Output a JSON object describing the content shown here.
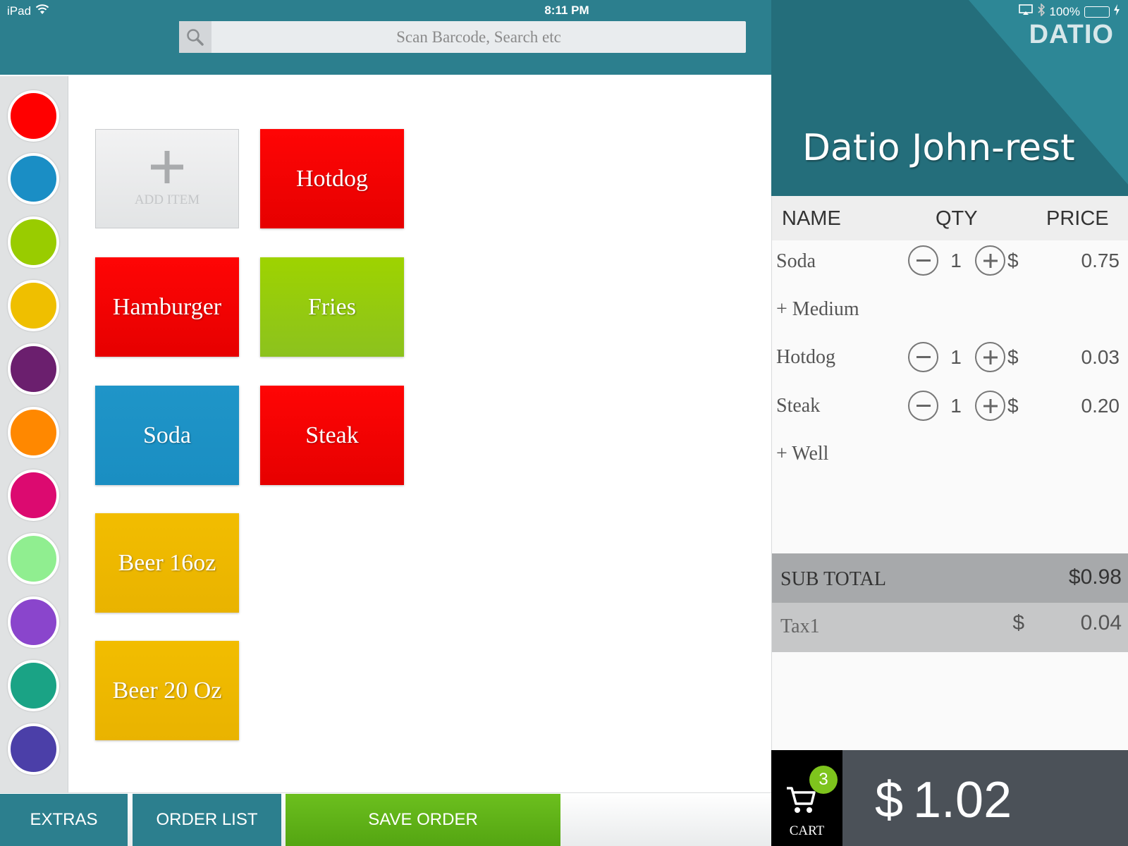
{
  "status": {
    "device": "iPad",
    "time": "8:11 PM",
    "battery": "100%"
  },
  "search": {
    "placeholder": "Scan Barcode, Search etc"
  },
  "palette": [
    "#ff0000",
    "#1a8ec5",
    "#99cc00",
    "#efbf00",
    "#6b1f6e",
    "#ff8800",
    "#dc0a70",
    "#90ee90",
    "#8a45cc",
    "#1aa385",
    "#4b3fa8"
  ],
  "items": {
    "add_label": "ADD ITEM",
    "hotdog": "Hotdog",
    "hamburger": "Hamburger",
    "fries": "Fries",
    "soda": "Soda",
    "steak": "Steak",
    "beer16": "Beer 16oz",
    "beer20": "Beer 20 Oz"
  },
  "toolbar": {
    "extras": "EXTRAS",
    "order_list": "ORDER LIST",
    "save_order": "SAVE ORDER"
  },
  "header": {
    "brand": "DATIO",
    "store_name": "Datio John-rest"
  },
  "cart": {
    "col_name": "NAME",
    "col_qty": "QTY",
    "col_price": "PRICE",
    "currency": "$",
    "rows": [
      {
        "name": "Soda",
        "qty": "1",
        "price": "0.75",
        "modifier": "+ Medium"
      },
      {
        "name": "Hotdog",
        "qty": "1",
        "price": "0.03"
      },
      {
        "name": "Steak",
        "qty": "1",
        "price": "0.20",
        "modifier": "+ Well"
      }
    ],
    "subtotal_label": "SUB TOTAL",
    "subtotal_value": "$0.98",
    "tax_label": "Tax1",
    "tax_currency": "$",
    "tax_value": "0.04"
  },
  "footer": {
    "cart_count": "3",
    "cart_label": "CART",
    "total_currency": "$",
    "total_value": "1.02"
  }
}
